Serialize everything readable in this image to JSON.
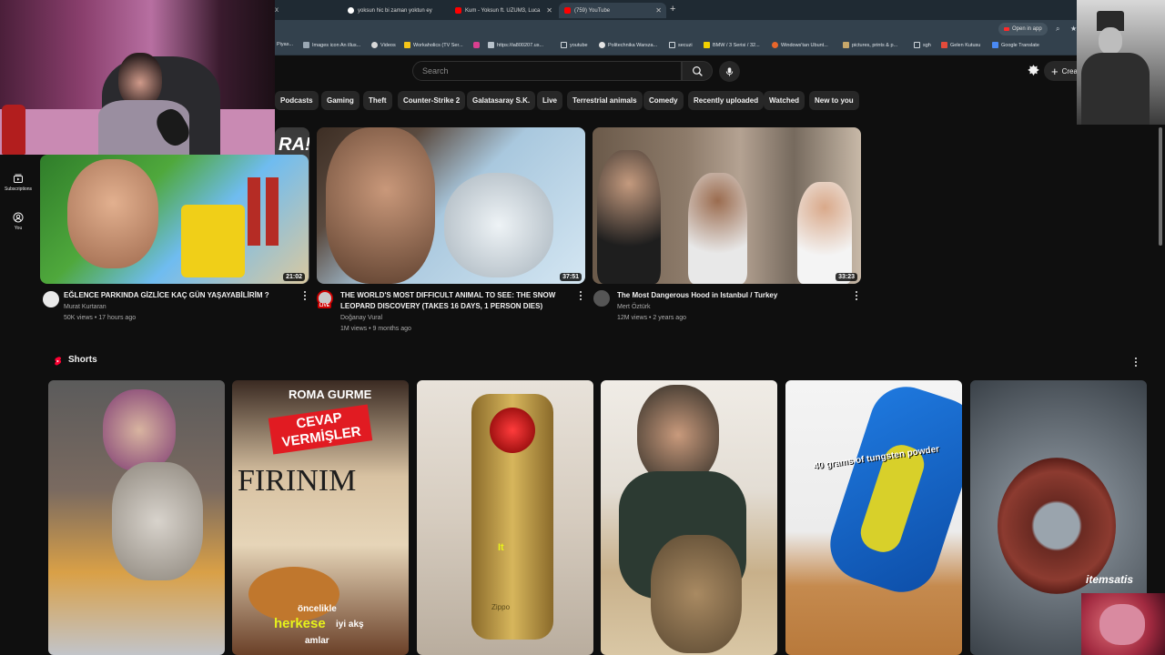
{
  "browser": {
    "tabs": [
      {
        "label": "X",
        "icon": "tab-icon"
      },
      {
        "label": "yoksun hic bi zaman yoktun ey",
        "icon": "google-icon"
      },
      {
        "label": "Kum - Yoksun ft. UZUM3, Luca",
        "icon": "youtube-icon"
      },
      {
        "label": "(759) YouTube",
        "icon": "youtube-icon"
      }
    ],
    "open_in_app": "Open in app",
    "bookmarks": [
      "Piyas...",
      "Images icon An illus...",
      "Videos",
      "Workaholics (TV Ser...",
      "https://ia800207.us...",
      "youtube",
      "Politechnika Warsza...",
      "secuzi",
      "BMW / 3 Serisi / 32...",
      "Windows'tan Ubunt...",
      "pictures, prints & p...",
      "sgh",
      "Gelen Kutusu",
      "Google Translate"
    ]
  },
  "header": {
    "search_placeholder": "Search",
    "create_label": "Crea"
  },
  "chips": [
    "Podcasts",
    "Gaming",
    "Theft",
    "Counter-Strike 2",
    "Galatasaray S.K.",
    "Live",
    "Terrestrial animals",
    "Comedy",
    "Recently uploaded",
    "Watched",
    "New to you"
  ],
  "sidenav": {
    "subscriptions": "Subscriptions",
    "you": "You"
  },
  "overlay": {
    "partial_thumb_text": "RA!",
    "watermark": "itemsatis",
    "live_badge": "LIVE"
  },
  "videos": [
    {
      "title": "EĞLENCE PARKINDA GİZLİCE KAÇ GÜN YAŞAYABİLİRİM ?",
      "channel": "Murat Kurtaran",
      "meta": "50K views • 17 hours ago",
      "duration": "21:02"
    },
    {
      "title": "THE WORLD'S MOST DIFFICULT ANIMAL TO SEE: THE SNOW LEOPARD DISCOVERY (TAKES 16 DAYS, 1 PERSON DIES)",
      "channel": "Doğanay Vural",
      "meta": "1M views • 9 months ago",
      "duration": "37:51"
    },
    {
      "title": "The Most Dangerous Hood in Istanbul / Turkey",
      "channel": "Mert Öztürk",
      "meta": "12M views • 2 years ago",
      "duration": "33:23"
    }
  ],
  "shorts": {
    "title": "Shorts",
    "items": [
      {
        "caption": ""
      },
      {
        "top_text": "ROMA GURME",
        "banner": "CEVAP VERMİŞLER",
        "sign": "FIRINIM",
        "caption_1": "öncelikle",
        "caption_2": "herkese",
        "caption_3": "iyi akş",
        "caption_4": "amlar"
      },
      {
        "caption": "It",
        "brand": "Zippo"
      },
      {
        "caption": ""
      },
      {
        "caption": "40 grams of tungsten powder"
      },
      {
        "caption": ""
      }
    ]
  }
}
